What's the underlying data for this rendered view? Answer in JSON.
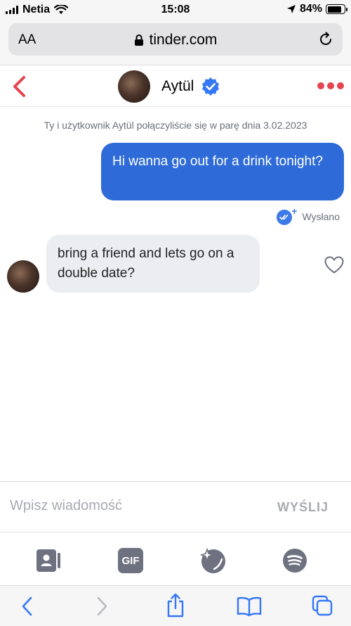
{
  "status_bar": {
    "carrier": "Netia",
    "time": "15:08",
    "battery": "84%",
    "battery_level": 0.84
  },
  "browser": {
    "text_size_label": "AA",
    "domain": "tinder.com"
  },
  "chat": {
    "contact_name": "Aytül",
    "verified": true,
    "match_info": "Ty i użytkownik Aytül połączyliście się w parę dnia 3.02.2023",
    "messages": [
      {
        "direction": "outgoing",
        "text": "Hi wanna go out for a drink tonight?"
      },
      {
        "direction": "incoming",
        "text": "bring a friend and lets go on a double date?"
      }
    ],
    "sent_status": "Wysłano"
  },
  "composer": {
    "placeholder": "Wpisz wiadomość",
    "send_label": "WYŚLIJ"
  },
  "toolbar": {
    "gif_label": "GIF",
    "icons": [
      "contact-card-icon",
      "gif-icon",
      "sparkle-icon",
      "spotify-icon"
    ]
  },
  "safari_toolbar": {
    "icons": [
      "back-icon",
      "forward-icon",
      "share-icon",
      "bookmarks-icon",
      "tabs-icon"
    ]
  },
  "colors": {
    "brand_red": "#e5444e",
    "outgoing_bubble": "#2e6bd9",
    "incoming_bubble": "#ecedf0",
    "ios_blue": "#3478f6"
  }
}
